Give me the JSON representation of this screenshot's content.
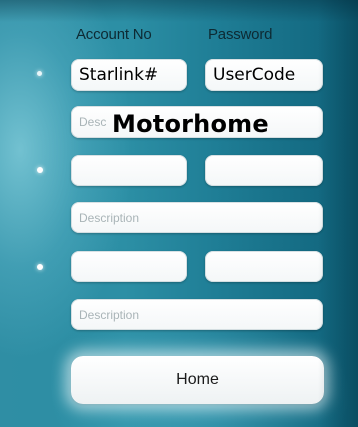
{
  "headers": {
    "account_no": "Account No",
    "password": "Password"
  },
  "rows": [
    {
      "account_value": "Starlink#",
      "password_value": "UserCode",
      "description_placeholder": "Desc",
      "description_overlay": "Motorhome"
    },
    {
      "account_value": "",
      "password_value": "",
      "description_placeholder": "Description"
    },
    {
      "account_value": "",
      "password_value": "",
      "description_placeholder": "Description"
    }
  ],
  "home_button": {
    "label": "Home"
  },
  "colors": {
    "background": "#2c8fa5",
    "field": "#ffffff",
    "header_text": "#0d2a33"
  }
}
